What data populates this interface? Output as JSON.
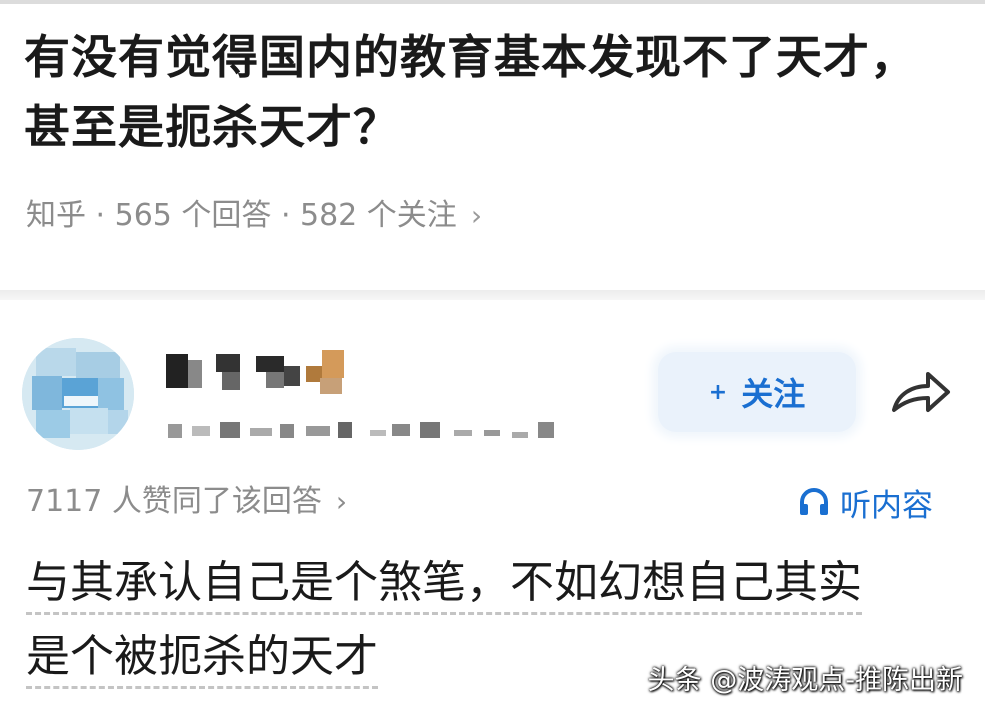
{
  "question": {
    "title": "有没有觉得国内的教育基本发现不了天才，甚至是扼杀天才？",
    "meta": "知乎 · 565 个回答 · 582 个关注",
    "chevron": "›"
  },
  "answer": {
    "follow_plus": "+",
    "follow_label": "关注",
    "likes_text": "7117 人赞同了该回答",
    "likes_chevron": "›",
    "listen_label": "听内容",
    "content_line1": "与其承认自己是个煞笔，不如幻想自己其实",
    "content_line2": "是个被扼杀的天才"
  },
  "watermark": "头条 @波涛观点-推陈出新",
  "colors": {
    "accent": "#1a6fd1",
    "meta_gray": "#8c8c8c",
    "follow_bg": "#eaf2fb"
  },
  "icons": {
    "share": "share-arrow-icon",
    "listen": "headphones-icon",
    "avatar": "pixelated-avatar"
  }
}
